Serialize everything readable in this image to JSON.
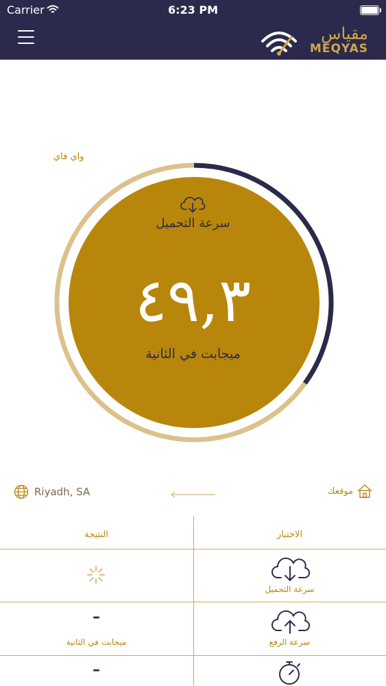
{
  "status_bar": {
    "carrier": "Carrier",
    "time": "6:23 PM"
  },
  "header": {
    "logo_ar": "مقياس",
    "logo_en": "MEQYAS"
  },
  "connection": {
    "type": "واي فاي"
  },
  "gauge": {
    "label": "سرعة التحميل",
    "value": "٤٩,٣",
    "unit": "ميجابت في الثانية",
    "progress_fraction": 0.35,
    "colors": {
      "fill": "#b8860b",
      "ring": "#dcc18a",
      "progress": "#2b2a4c"
    }
  },
  "location": {
    "city": "Riyadh, SA",
    "my_location": "موقعك"
  },
  "results": {
    "col_test": "الاختبار",
    "col_result": "النتيجة",
    "rows": [
      {
        "test": "سرعة التحميل",
        "icon": "cloud-download-icon",
        "result": ""
      },
      {
        "test": "سرعة الرفع",
        "icon": "cloud-upload-icon",
        "result": "–",
        "unit": "ميجابت في الثانية"
      },
      {
        "test": "",
        "icon": "stopwatch-icon",
        "result": "–"
      }
    ]
  },
  "colors": {
    "navy": "#2b2a4c",
    "gold": "#b8860b",
    "light_gold": "#dcc18a"
  }
}
